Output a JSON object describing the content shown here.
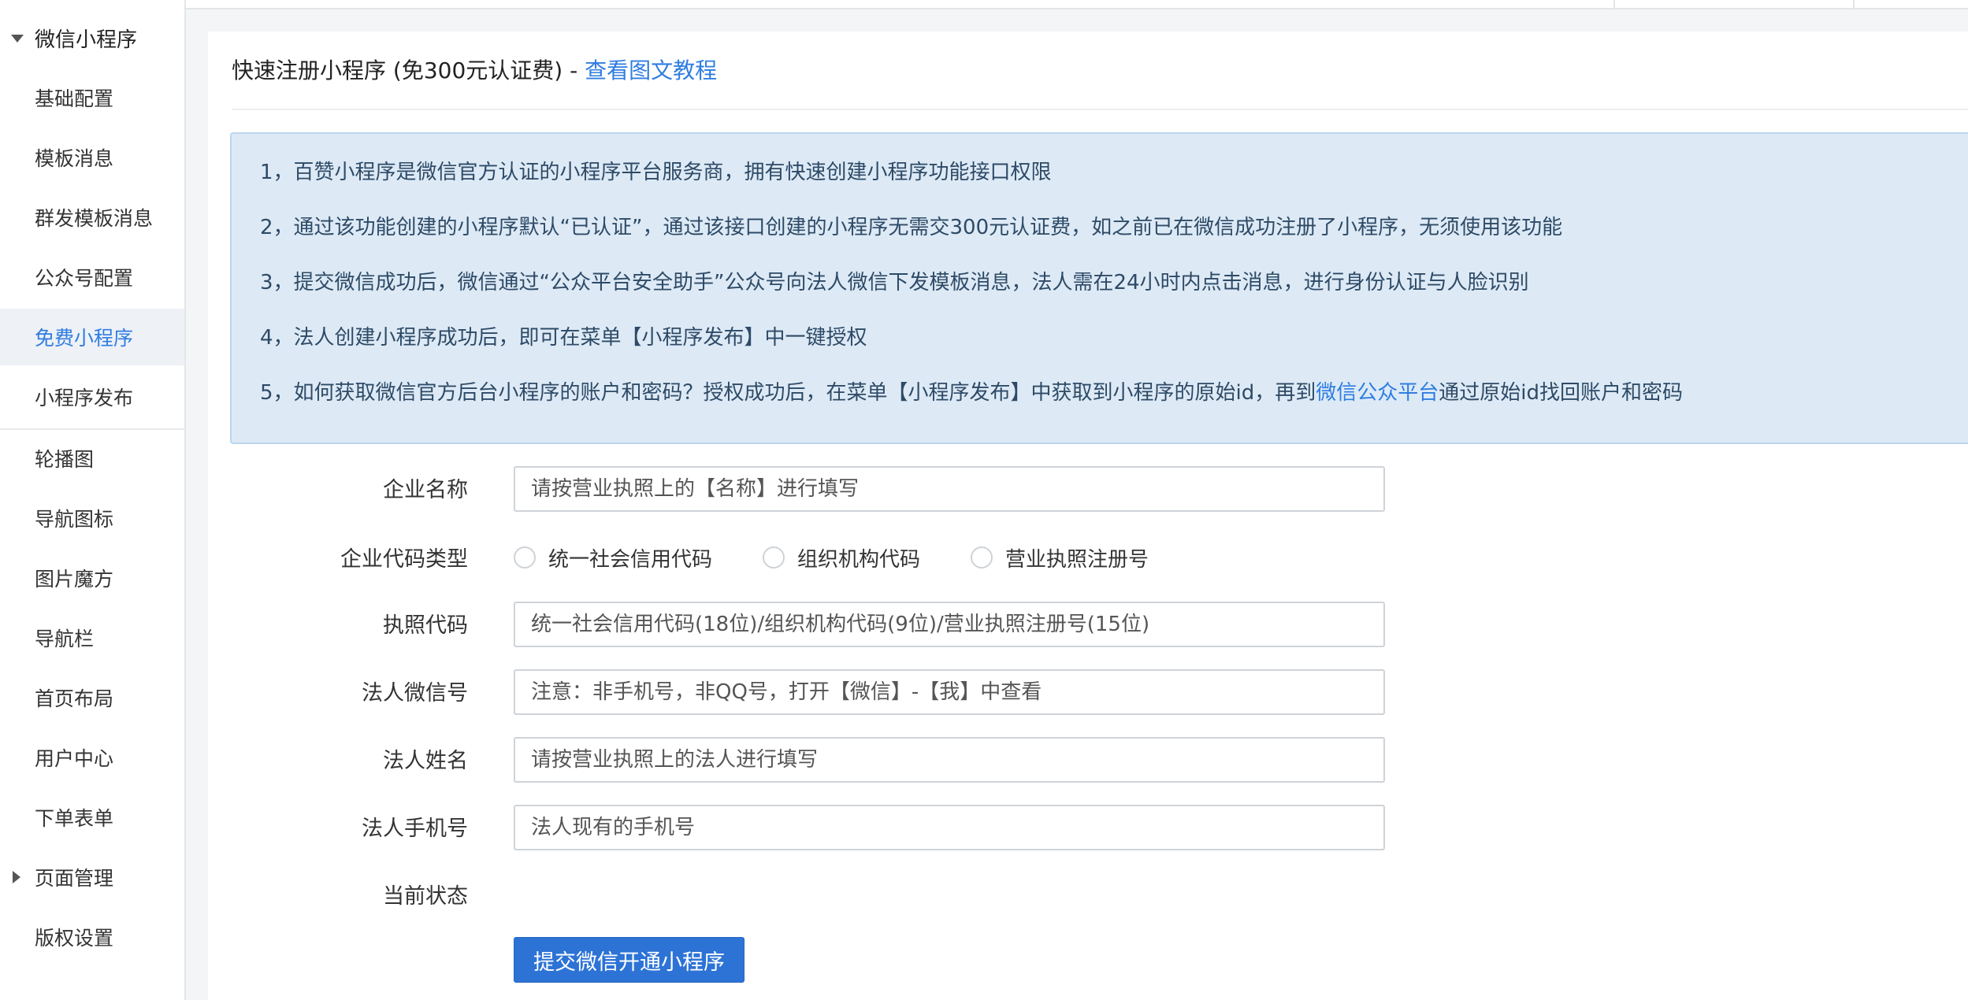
{
  "sidebar": {
    "group_label": "微信小程序",
    "items": [
      {
        "label": "基础配置"
      },
      {
        "label": "模板消息"
      },
      {
        "label": "群发模板消息"
      },
      {
        "label": "公众号配置"
      },
      {
        "label": "免费小程序"
      },
      {
        "label": "小程序发布"
      }
    ],
    "items2": [
      {
        "label": "轮播图"
      },
      {
        "label": "导航图标"
      },
      {
        "label": "图片魔方"
      },
      {
        "label": "导航栏"
      },
      {
        "label": "首页布局"
      },
      {
        "label": "用户中心"
      },
      {
        "label": "下单表单"
      },
      {
        "label": "页面管理"
      },
      {
        "label": "版权设置"
      }
    ]
  },
  "header": {
    "title": "快速注册小程序 (免300元认证费) - ",
    "tutorial_link": "查看图文教程"
  },
  "notice": {
    "line1": "1，百赞小程序是微信官方认证的小程序平台服务商，拥有快速创建小程序功能接口权限",
    "line2": "2，通过该功能创建的小程序默认“已认证”，通过该接口创建的小程序无需交300元认证费，如之前已在微信成功注册了小程序，无须使用该功能",
    "line3": "3，提交微信成功后，微信通过“公众平台安全助手”公众号向法人微信下发模板消息，法人需在24小时内点击消息，进行身份认证与人脸识别",
    "line4": "4，法人创建小程序成功后，即可在菜单【小程序发布】中一键授权",
    "line5_pre": "5，如何获取微信官方后台小程序的账户和密码？授权成功后，在菜单【小程序发布】中获取到小程序的原始id，再到",
    "line5_link": "微信公众平台",
    "line5_post": "通过原始id找回账户和密码"
  },
  "form": {
    "company_name": {
      "label": "企业名称",
      "placeholder": "请按营业执照上的【名称】进行填写",
      "value": ""
    },
    "code_type": {
      "label": "企业代码类型",
      "options": [
        "统一社会信用代码",
        "组织机构代码",
        "营业执照注册号"
      ]
    },
    "license_code": {
      "label": "执照代码",
      "placeholder": "统一社会信用代码(18位)/组织机构代码(9位)/营业执照注册号(15位)",
      "value": ""
    },
    "legal_wechat": {
      "label": "法人微信号",
      "placeholder": "注意：非手机号，非QQ号，打开【微信】-【我】中查看",
      "value": ""
    },
    "legal_name": {
      "label": "法人姓名",
      "placeholder": "请按营业执照上的法人进行填写",
      "value": ""
    },
    "legal_phone": {
      "label": "法人手机号",
      "placeholder": "法人现有的手机号",
      "value": ""
    },
    "status": {
      "label": "当前状态",
      "value": ""
    },
    "submit_label": "提交微信开通小程序"
  },
  "colors": {
    "accent": "#2d73d6",
    "link": "#2f7de1",
    "notice_bg": "#ddeaf6",
    "sidebar_active_bg": "#eef1f6"
  }
}
